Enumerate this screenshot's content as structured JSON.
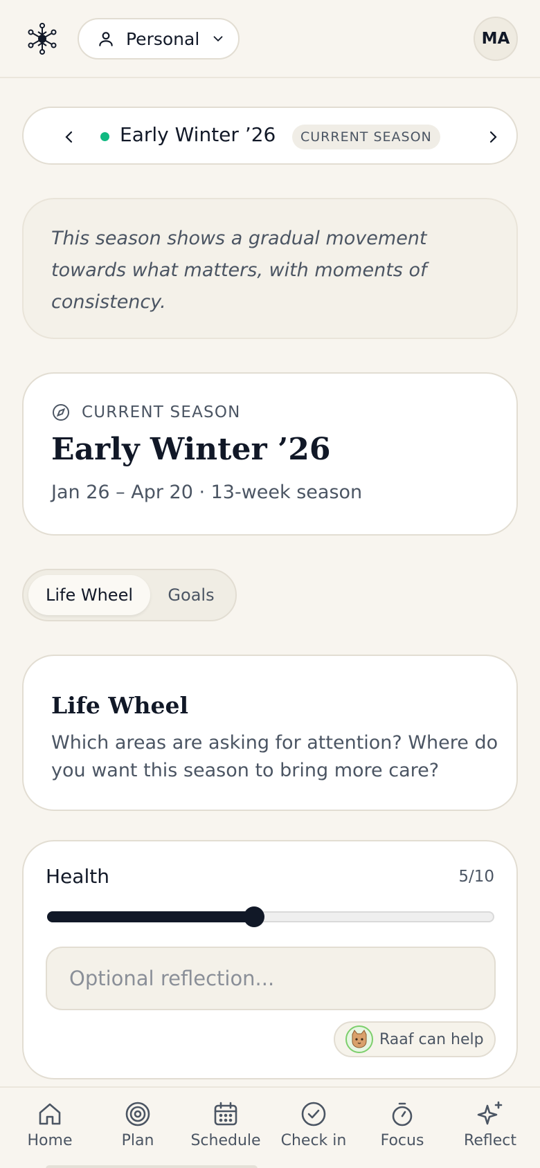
{
  "header": {
    "logo_icon": "snowflake-icon",
    "profile_label": "Personal",
    "profile_icon": "user-icon",
    "avatar_initials": "MA"
  },
  "season_selector": {
    "name": "Early Winter ’26",
    "badge": "CURRENT SEASON",
    "status_color": "#10b981"
  },
  "insight": {
    "text": "This season shows a gradual movement towards what matters, with moments of consistency."
  },
  "current_season": {
    "label": "CURRENT SEASON",
    "icon": "compass-icon",
    "title": "Early Winter ’26",
    "dates": "Jan 26 – Apr 20 · 13-week season"
  },
  "tabs": [
    {
      "label": "Life Wheel",
      "active": true
    },
    {
      "label": "Goals",
      "active": false
    }
  ],
  "life_wheel": {
    "title": "Life Wheel",
    "description": "Which areas are asking for attention? Where do you want this season to bring more care?"
  },
  "health": {
    "label": "Health",
    "score_text": "5/10",
    "value": 5,
    "max": 10,
    "reflection_placeholder": "Optional reflection...",
    "helper_label": "Raaf can help",
    "helper_icon": "cat-icon"
  },
  "bottom_nav": [
    {
      "label": "Home",
      "icon": "home-icon"
    },
    {
      "label": "Plan",
      "icon": "target-icon"
    },
    {
      "label": "Schedule",
      "icon": "calendar-icon"
    },
    {
      "label": "Check in",
      "icon": "check-circle-icon"
    },
    {
      "label": "Focus",
      "icon": "stopwatch-icon"
    },
    {
      "label": "Reflect",
      "icon": "sparkles-icon"
    }
  ],
  "colors": {
    "background": "#f8f5ef",
    "card": "#ffffff",
    "accent": "#111827",
    "muted": "#4b5563"
  }
}
